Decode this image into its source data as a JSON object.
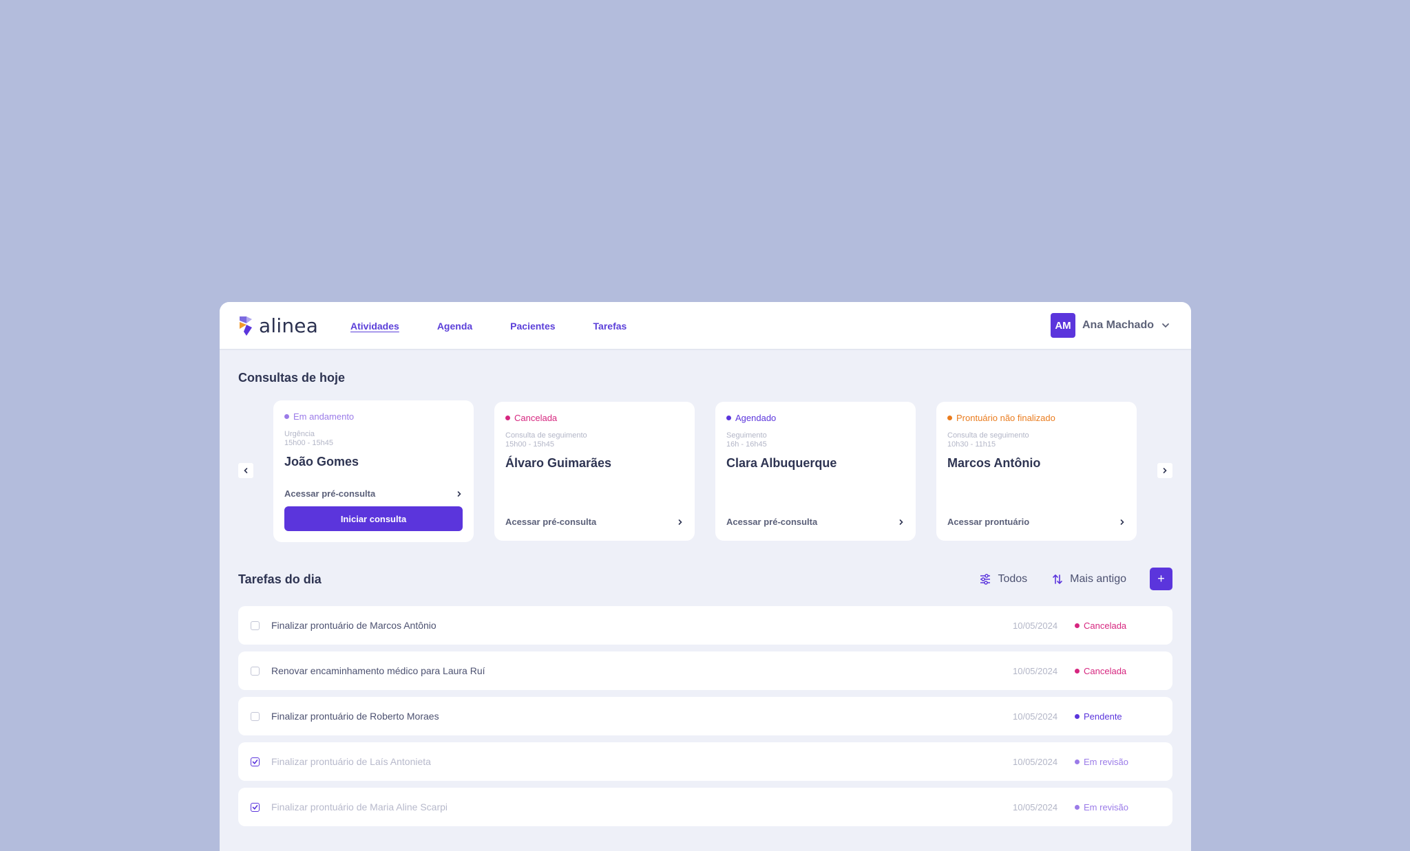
{
  "app": {
    "brand": "alinea"
  },
  "nav": [
    {
      "label": "Atividades",
      "active": true
    },
    {
      "label": "Agenda",
      "active": false
    },
    {
      "label": "Pacientes",
      "active": false
    },
    {
      "label": "Tarefas",
      "active": false
    }
  ],
  "user": {
    "initials": "AM",
    "name": "Ana Machado"
  },
  "consultas": {
    "title": "Consultas de hoje",
    "cards": [
      {
        "status": "Em andamento",
        "status_color": "#9b7be8",
        "type": "Urgência",
        "time": "15h00 - 15h45",
        "name": "João Gomes",
        "link": "Acessar pré-consulta",
        "action": "Iniciar consulta"
      },
      {
        "status": "Cancelada",
        "status_color": "#d6267f",
        "type": "Consulta de seguimento",
        "time": "15h00 - 15h45",
        "name": "Álvaro Guimarães",
        "link": "Acessar pré-consulta"
      },
      {
        "status": "Agendado",
        "status_color": "#5b35dc",
        "type": "Seguimento",
        "time": "16h - 16h45",
        "name": "Clara Albuquerque",
        "link": "Acessar pré-consulta"
      },
      {
        "status": "Prontuário não finalizado",
        "status_color": "#ea7c1e",
        "type": "Consulta de seguimento",
        "time": "10h30 - 11h15",
        "name": "Marcos Antônio",
        "link": "Acessar prontuário"
      }
    ]
  },
  "tarefas": {
    "title": "Tarefas do dia",
    "filter_label": "Todos",
    "sort_label": "Mais antigo",
    "add_label": "+",
    "items": [
      {
        "text": "Finalizar prontuário de Marcos Antônio",
        "date": "10/05/2024",
        "status": "Cancelada",
        "status_color": "#d6267f",
        "checked": false
      },
      {
        "text": "Renovar encaminhamento médico para Laura Ruí",
        "date": "10/05/2024",
        "status": "Cancelada",
        "status_color": "#d6267f",
        "checked": false
      },
      {
        "text": "Finalizar prontuário de Roberto Moraes",
        "date": "10/05/2024",
        "status": "Pendente",
        "status_color": "#5b35dc",
        "checked": false
      },
      {
        "text": "Finalizar prontuário de Laís Antonieta",
        "date": "10/05/2024",
        "status": "Em revisão",
        "status_color": "#9b7be8",
        "checked": true
      },
      {
        "text": "Finalizar prontuário de Maria Aline Scarpi",
        "date": "10/05/2024",
        "status": "Em revisão",
        "status_color": "#9b7be8",
        "checked": true
      }
    ]
  },
  "colors": {
    "accent": "#5b35dc",
    "background": "#b3bcdc",
    "panel": "#eef0f8"
  },
  "icons": [
    "logo-mark",
    "chevron-down-icon",
    "chevron-left-icon",
    "chevron-right-icon",
    "filter-icon",
    "sort-icon",
    "check-icon"
  ]
}
